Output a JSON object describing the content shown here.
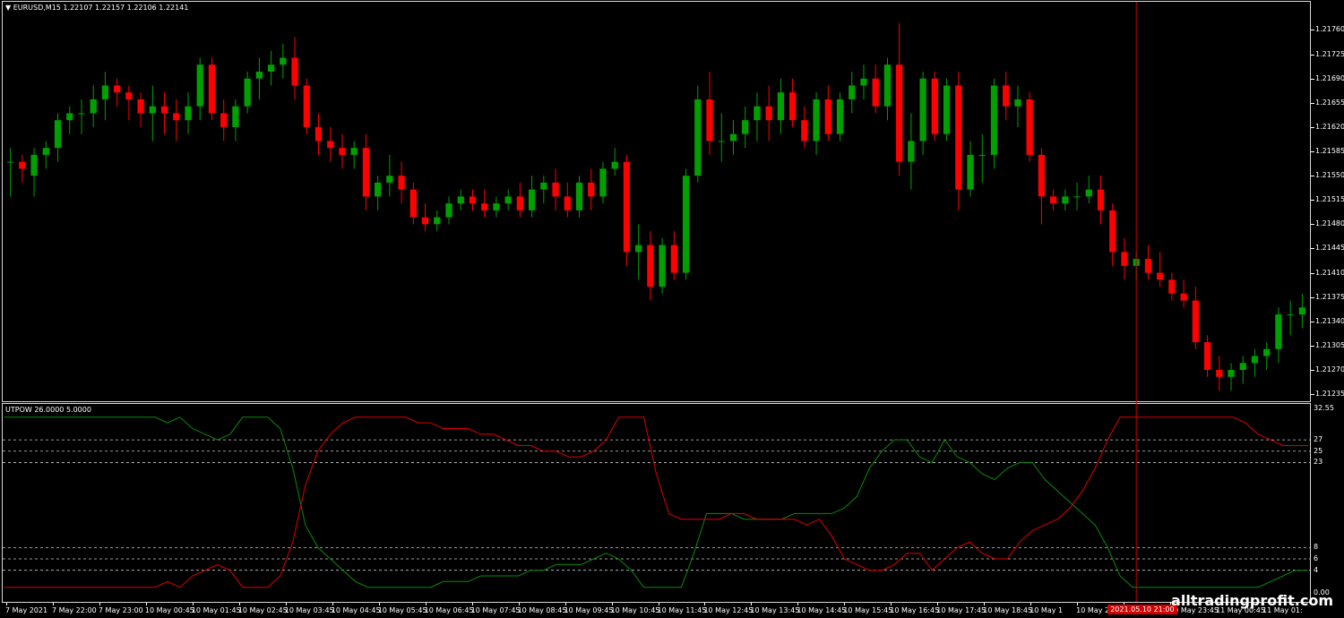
{
  "header": {
    "symbol_line": "EURUSD,M15  1.22107 1.22157 1.22106 1.22141",
    "dropdown_glyph": "▼"
  },
  "indicator": {
    "header": "UTPOW 26.0000 5.0000",
    "levels": [
      "32.55",
      "27",
      "25",
      "23",
      "8",
      "6",
      "4",
      "0.00"
    ]
  },
  "price_axis": [
    "1.21760",
    "1.21725",
    "1.21690",
    "1.21655",
    "1.21620",
    "1.21585",
    "1.21550",
    "1.21515",
    "1.21480",
    "1.21445",
    "1.21410",
    "1.21375",
    "1.21340",
    "1.21305",
    "1.21270",
    "1.21235"
  ],
  "time_axis": [
    "7 May 2021",
    "7 May 22:00",
    "7 May 23:00",
    "10 May 00:45",
    "10 May 01:45",
    "10 May 02:45",
    "10 May 03:45",
    "10 May 04:45",
    "10 May 05:45",
    "10 May 06:45",
    "10 May 07:45",
    "10 May 08:45",
    "10 May 09:45",
    "10 May 10:45",
    "10 May 11:45",
    "10 May 12:45",
    "10 May 13:45",
    "10 May 14:45",
    "10 May 15:45",
    "10 May 16:45",
    "10 May 17:45",
    "10 May 18:45",
    "10 May 1",
    "10 May 21:45",
    "10 May 22:45",
    "10 May 23:45",
    "11 May 00:45",
    "11 May 01:"
  ],
  "cursor_time": "2021.05.10 21:00",
  "watermark": "alltradingprofit.com",
  "colors": {
    "bull": "#00a000",
    "bear": "#ff0000",
    "grid_dash": "#c8c8c8",
    "cursor_line": "#c00000",
    "ind_green": "#0a8a0a",
    "ind_red": "#e00000"
  },
  "chart_data": {
    "type": "candlestick",
    "ylim": [
      1.2123,
      1.2178
    ],
    "candles_ohlc": [
      [
        1.2157,
        1.2159,
        1.2152,
        1.2157
      ],
      [
        1.2157,
        1.2158,
        1.2154,
        1.2156
      ],
      [
        1.2155,
        1.2159,
        1.2152,
        1.2158
      ],
      [
        1.2158,
        1.216,
        1.2156,
        1.2159
      ],
      [
        1.2159,
        1.2164,
        1.2157,
        1.2163
      ],
      [
        1.2163,
        1.2165,
        1.2161,
        1.2164
      ],
      [
        1.2164,
        1.2166,
        1.2161,
        1.2164
      ],
      [
        1.2164,
        1.2168,
        1.2162,
        1.2166
      ],
      [
        1.2166,
        1.217,
        1.2163,
        1.2168
      ],
      [
        1.2168,
        1.2169,
        1.2165,
        1.2167
      ],
      [
        1.2167,
        1.2168,
        1.2163,
        1.2166
      ],
      [
        1.2166,
        1.2167,
        1.2162,
        1.2164
      ],
      [
        1.2164,
        1.2168,
        1.216,
        1.2165
      ],
      [
        1.2165,
        1.2167,
        1.2161,
        1.2164
      ],
      [
        1.2164,
        1.2166,
        1.216,
        1.2163
      ],
      [
        1.2163,
        1.2167,
        1.2161,
        1.2165
      ],
      [
        1.2165,
        1.2172,
        1.2163,
        1.2171
      ],
      [
        1.2171,
        1.2172,
        1.2163,
        1.2164
      ],
      [
        1.2164,
        1.2166,
        1.216,
        1.2162
      ],
      [
        1.2162,
        1.2166,
        1.216,
        1.2165
      ],
      [
        1.2165,
        1.217,
        1.2164,
        1.2169
      ],
      [
        1.2169,
        1.2172,
        1.2166,
        1.217
      ],
      [
        1.217,
        1.2173,
        1.2168,
        1.2171
      ],
      [
        1.2171,
        1.2174,
        1.2169,
        1.2172
      ],
      [
        1.2172,
        1.2175,
        1.2166,
        1.2168
      ],
      [
        1.2168,
        1.2169,
        1.2161,
        1.2162
      ],
      [
        1.2162,
        1.2164,
        1.2158,
        1.216
      ],
      [
        1.216,
        1.2162,
        1.2157,
        1.2159
      ],
      [
        1.2159,
        1.2161,
        1.2156,
        1.2158
      ],
      [
        1.2158,
        1.216,
        1.2156,
        1.2159
      ],
      [
        1.2159,
        1.2161,
        1.215,
        1.2152
      ],
      [
        1.2152,
        1.2155,
        1.215,
        1.2154
      ],
      [
        1.2154,
        1.2158,
        1.2152,
        1.2155
      ],
      [
        1.2155,
        1.2157,
        1.2151,
        1.2153
      ],
      [
        1.2153,
        1.2154,
        1.2148,
        1.2149
      ],
      [
        1.2149,
        1.2151,
        1.2147,
        1.2148
      ],
      [
        1.2148,
        1.215,
        1.2147,
        1.2149
      ],
      [
        1.2149,
        1.2152,
        1.2148,
        1.2151
      ],
      [
        1.2151,
        1.2153,
        1.215,
        1.2152
      ],
      [
        1.2152,
        1.2153,
        1.215,
        1.2151
      ],
      [
        1.2151,
        1.2153,
        1.2149,
        1.215
      ],
      [
        1.215,
        1.2152,
        1.2149,
        1.2151
      ],
      [
        1.2151,
        1.2153,
        1.215,
        1.2152
      ],
      [
        1.2152,
        1.2154,
        1.2149,
        1.215
      ],
      [
        1.215,
        1.2155,
        1.2149,
        1.2153
      ],
      [
        1.2153,
        1.2155,
        1.2151,
        1.2154
      ],
      [
        1.2154,
        1.2156,
        1.215,
        1.2152
      ],
      [
        1.2152,
        1.2154,
        1.2149,
        1.215
      ],
      [
        1.215,
        1.2155,
        1.2149,
        1.2154
      ],
      [
        1.2154,
        1.2156,
        1.215,
        1.2152
      ],
      [
        1.2152,
        1.2157,
        1.2151,
        1.2156
      ],
      [
        1.2156,
        1.2159,
        1.2155,
        1.2157
      ],
      [
        1.2157,
        1.2158,
        1.2142,
        1.2144
      ],
      [
        1.2144,
        1.2148,
        1.214,
        1.2145
      ],
      [
        1.2145,
        1.2147,
        1.2137,
        1.2139
      ],
      [
        1.2139,
        1.2146,
        1.2138,
        1.2145
      ],
      [
        1.2145,
        1.2147,
        1.214,
        1.2141
      ],
      [
        1.2141,
        1.2156,
        1.214,
        1.2155
      ],
      [
        1.2155,
        1.2168,
        1.2154,
        1.2166
      ],
      [
        1.2166,
        1.217,
        1.2158,
        1.216
      ],
      [
        1.216,
        1.2164,
        1.2157,
        1.216
      ],
      [
        1.216,
        1.2163,
        1.2158,
        1.2161
      ],
      [
        1.2161,
        1.2165,
        1.2159,
        1.2163
      ],
      [
        1.2163,
        1.2167,
        1.216,
        1.2165
      ],
      [
        1.2165,
        1.2168,
        1.216,
        1.2163
      ],
      [
        1.2163,
        1.2169,
        1.2161,
        1.2167
      ],
      [
        1.2167,
        1.2169,
        1.2162,
        1.2163
      ],
      [
        1.2163,
        1.2165,
        1.2159,
        1.216
      ],
      [
        1.216,
        1.2167,
        1.2158,
        1.2166
      ],
      [
        1.2166,
        1.2168,
        1.216,
        1.2161
      ],
      [
        1.2161,
        1.2167,
        1.216,
        1.2166
      ],
      [
        1.2166,
        1.217,
        1.2164,
        1.2168
      ],
      [
        1.2168,
        1.2171,
        1.2166,
        1.2169
      ],
      [
        1.2169,
        1.2171,
        1.2164,
        1.2165
      ],
      [
        1.2165,
        1.2172,
        1.2163,
        1.2171
      ],
      [
        1.2171,
        1.2177,
        1.2155,
        1.2157
      ],
      [
        1.2157,
        1.2164,
        1.2153,
        1.216
      ],
      [
        1.216,
        1.217,
        1.2158,
        1.2169
      ],
      [
        1.2169,
        1.217,
        1.216,
        1.2161
      ],
      [
        1.2161,
        1.2169,
        1.216,
        1.2168
      ],
      [
        1.2168,
        1.217,
        1.215,
        1.2153
      ],
      [
        1.2153,
        1.216,
        1.2152,
        1.2158
      ],
      [
        1.2158,
        1.2161,
        1.2154,
        1.2158
      ],
      [
        1.2158,
        1.2169,
        1.2156,
        1.2168
      ],
      [
        1.2168,
        1.217,
        1.2163,
        1.2165
      ],
      [
        1.2165,
        1.2168,
        1.2162,
        1.2166
      ],
      [
        1.2166,
        1.2167,
        1.2157,
        1.2158
      ],
      [
        1.2158,
        1.2159,
        1.2148,
        1.2152
      ],
      [
        1.2152,
        1.2153,
        1.215,
        1.2151
      ],
      [
        1.2151,
        1.2153,
        1.215,
        1.2152
      ],
      [
        1.2152,
        1.2154,
        1.215,
        1.2152
      ],
      [
        1.2152,
        1.2155,
        1.2151,
        1.2153
      ],
      [
        1.2153,
        1.2155,
        1.2148,
        1.215
      ],
      [
        1.215,
        1.2151,
        1.2142,
        1.2144
      ],
      [
        1.2144,
        1.2146,
        1.214,
        1.2142
      ],
      [
        1.2142,
        1.2144,
        1.214,
        1.2143
      ],
      [
        1.2143,
        1.2145,
        1.214,
        1.2141
      ],
      [
        1.2141,
        1.2144,
        1.2139,
        1.214
      ],
      [
        1.214,
        1.2141,
        1.2137,
        1.2138
      ],
      [
        1.2138,
        1.214,
        1.2136,
        1.2137
      ],
      [
        1.2137,
        1.2139,
        1.213,
        1.2131
      ],
      [
        1.2131,
        1.2132,
        1.2126,
        1.2127
      ],
      [
        1.2127,
        1.2129,
        1.2124,
        1.2126
      ],
      [
        1.2126,
        1.2128,
        1.2124,
        1.2127
      ],
      [
        1.2127,
        1.2129,
        1.2125,
        1.2128
      ],
      [
        1.2128,
        1.213,
        1.2126,
        1.2129
      ],
      [
        1.2129,
        1.2131,
        1.2127,
        1.213
      ],
      [
        1.213,
        1.2136,
        1.2128,
        1.2135
      ],
      [
        1.2135,
        1.2137,
        1.2132,
        1.2135
      ],
      [
        1.2135,
        1.2138,
        1.2133,
        1.2136
      ]
    ],
    "indicator_series": [
      {
        "color": "green",
        "values": [
          31,
          31,
          31,
          31,
          31,
          31,
          31,
          31,
          31,
          31,
          31,
          31,
          31,
          30,
          31,
          29,
          28,
          27,
          28,
          31,
          31,
          31,
          29,
          22,
          12,
          8,
          6,
          4,
          2,
          1,
          1,
          1,
          1,
          1,
          1,
          2,
          2,
          2,
          3,
          3,
          3,
          3,
          4,
          4,
          5,
          5,
          5,
          6,
          7,
          6,
          4,
          1,
          1,
          1,
          1,
          7,
          14,
          14,
          14,
          13,
          13,
          13,
          13,
          14,
          14,
          14,
          14,
          15,
          17,
          22,
          25,
          27,
          27,
          24,
          23,
          27,
          24,
          23,
          21,
          20,
          22,
          23,
          23,
          20,
          18,
          16,
          14,
          12,
          8,
          3,
          1,
          1,
          1,
          1,
          1,
          1,
          1,
          1,
          1,
          1,
          1,
          2,
          3,
          4,
          4
        ]
      },
      {
        "color": "red",
        "values": [
          1,
          1,
          1,
          1,
          1,
          1,
          1,
          1,
          1,
          1,
          1,
          1,
          1,
          2,
          1,
          3,
          4,
          5,
          4,
          1,
          1,
          1,
          3,
          9,
          19,
          25,
          28,
          30,
          31,
          31,
          31,
          31,
          31,
          30,
          30,
          29,
          29,
          29,
          28,
          28,
          27,
          26,
          26,
          25,
          25,
          24,
          24,
          25,
          27,
          31,
          31,
          31,
          21,
          14,
          13,
          13,
          13,
          13,
          14,
          14,
          13,
          13,
          13,
          13,
          12,
          13,
          10,
          6,
          5,
          4,
          4,
          5,
          7,
          7,
          4,
          6,
          8,
          9,
          7,
          6,
          6,
          9,
          11,
          12,
          13,
          15,
          18,
          22,
          27,
          31,
          31,
          31,
          31,
          31,
          31,
          31,
          31,
          31,
          31,
          30,
          28,
          27,
          26,
          26,
          26
        ]
      }
    ],
    "indicator_ylim": [
      0,
      32.55
    ]
  }
}
